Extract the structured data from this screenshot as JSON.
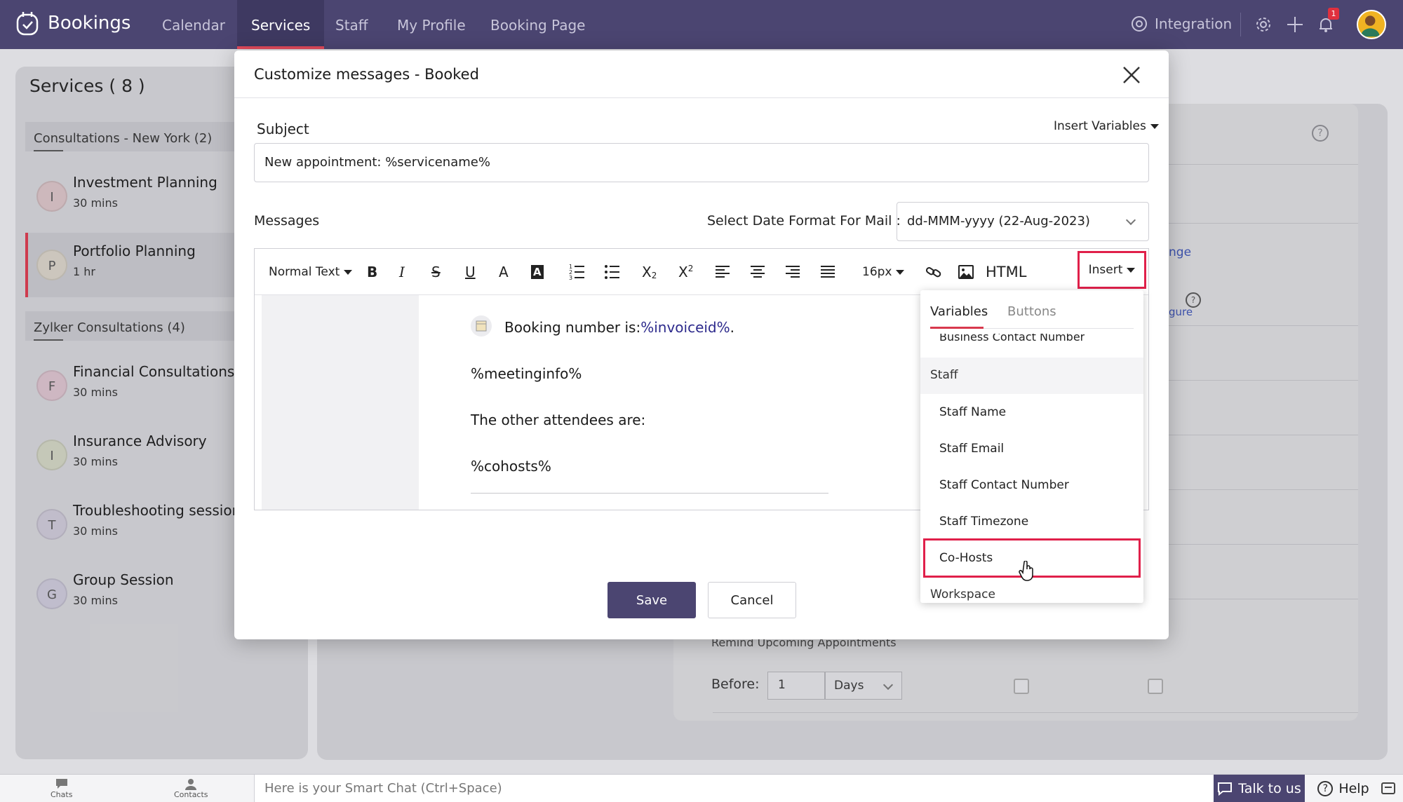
{
  "topnav": {
    "brand": "Bookings",
    "tabs": [
      {
        "label": "Calendar"
      },
      {
        "label": "Services"
      },
      {
        "label": "Staff"
      },
      {
        "label": "My Profile"
      },
      {
        "label": "Booking Page"
      }
    ],
    "active_tab": "Services",
    "integration_label": "Integration",
    "notification_count": "1",
    "accent_color": "#4b4571"
  },
  "services": {
    "title": "Services ( 8 )",
    "groups": [
      {
        "name": "Consultations - New York (2)",
        "items": [
          {
            "initial": "I",
            "name": "Investment Planning",
            "duration": "30 mins",
            "color": "#d7c0c4"
          },
          {
            "initial": "P",
            "name": "Portfolio Planning",
            "duration": "1 hr",
            "color": "#d6d0c5"
          }
        ]
      },
      {
        "name": "Zylker Consultations (4)",
        "items": [
          {
            "initial": "F",
            "name": "Financial Consultations",
            "duration": "30 mins",
            "color": "#d8bfca"
          },
          {
            "initial": "I",
            "name": "Insurance Advisory",
            "duration": "30 mins",
            "color": "#cfd2bf"
          },
          {
            "initial": "T",
            "name": "Troubleshooting session",
            "duration": "30 mins",
            "color": "#cac6d4"
          },
          {
            "initial": "G",
            "name": "Group Session",
            "duration": "30 mins",
            "color": "#c9c6d6"
          }
        ]
      }
    ]
  },
  "background": {
    "link_partial_1": "nge",
    "link_partial_2": "gure",
    "remind_label": "Remind Upcoming Appointments",
    "before_label": "Before:",
    "before_value": "1",
    "days_value": "Days"
  },
  "modal": {
    "title": "Customize messages - Booked",
    "subject_label": "Subject",
    "insert_variables_label": "Insert Variables",
    "subject_value": "New appointment: %servicename%",
    "messages_label": "Messages",
    "date_format_label": "Select Date Format For Mail :",
    "date_format_value": "dd-MMM-yyyy (22-Aug-2023)",
    "toolbar": {
      "text_style": "Normal Text",
      "font_size": "16px",
      "html_label": "HTML",
      "insert_label": "Insert",
      "icons": [
        "bold-icon",
        "italic-icon",
        "strikethrough-icon",
        "underline-icon",
        "font-color-icon",
        "highlight-icon",
        "ordered-list-icon",
        "bullet-list-icon",
        "subscript-icon",
        "superscript-icon",
        "align-left-icon",
        "align-center-icon",
        "align-right-icon",
        "justify-icon",
        "link-icon",
        "image-icon"
      ]
    },
    "body": {
      "booking_prefix": "Booking number is:",
      "booking_var": "%invoiceid%",
      "booking_suffix": ".",
      "meetinginfo": "%meetinginfo%",
      "attendees": "The other attendees are:",
      "cohosts": "%cohosts%"
    },
    "save_label": "Save",
    "cancel_label": "Cancel"
  },
  "insert_dropdown": {
    "tabs": [
      "Variables",
      "Buttons"
    ],
    "active_tab": "Variables",
    "clipped_item": "Business Contact Number",
    "sections": [
      {
        "name": "Staff",
        "items": [
          "Staff Name",
          "Staff Email",
          "Staff Contact Number",
          "Staff Timezone",
          "Co-Hosts"
        ]
      },
      {
        "name": "Workspace",
        "items": []
      }
    ],
    "highlighted_item": "Co-Hosts",
    "highlight_color": "#e0204a"
  },
  "bottombar": {
    "chats_label": "Chats",
    "contacts_label": "Contacts",
    "smart_chat_placeholder": "Here is your Smart Chat (Ctrl+Space)",
    "talk_label": "Talk to us",
    "help_label": "Help"
  }
}
